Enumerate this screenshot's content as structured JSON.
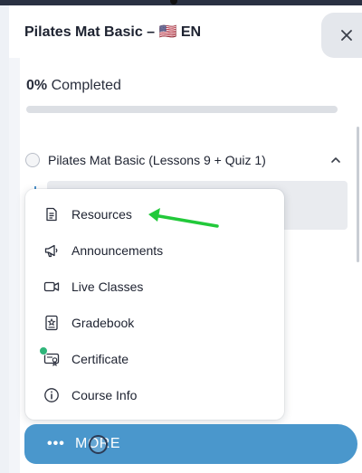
{
  "header": {
    "title": "Pilates Mat Basic – 🇺🇸 EN",
    "close_icon": "close-icon"
  },
  "progress": {
    "percent_text": "0%",
    "label_text": "Completed",
    "fraction": 0
  },
  "course": {
    "label": "Pilates Mat Basic (Lessons 9 + Quiz 1)",
    "chevron_icon": "chevron-up-icon"
  },
  "menu": {
    "items": [
      {
        "label": "Resources",
        "icon": "document-icon"
      },
      {
        "label": "Announcements",
        "icon": "megaphone-icon"
      },
      {
        "label": "Live Classes",
        "icon": "video-camera-icon"
      },
      {
        "label": "Gradebook",
        "icon": "gradebook-icon"
      },
      {
        "label": "Certificate",
        "icon": "certificate-icon"
      },
      {
        "label": "Course Info",
        "icon": "info-icon"
      }
    ]
  },
  "more_button": {
    "dots": "•••",
    "label": "MORE"
  },
  "colors": {
    "accent": "#4a97cc",
    "annotation_arrow": "#22c93a",
    "badge_green": "#2fb57a"
  }
}
